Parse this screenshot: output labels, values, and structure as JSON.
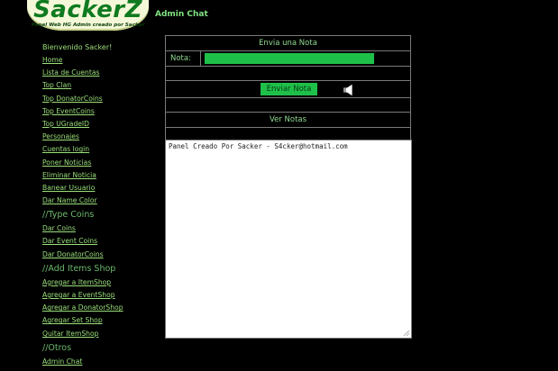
{
  "logo": {
    "title": "SackerZ",
    "subtitle": "Panel Web HG Admin creado por Sacker"
  },
  "page_title": "Admin Chat",
  "sidebar": {
    "welcome": "Bienvenido Sacker!",
    "links": [
      "Home",
      "Lista de Cuentas",
      "Top Clan",
      "Top DonatorCoins",
      "Top EventCoins",
      "Top UGradeID",
      "Personajes",
      "Cuentas login",
      "Poner Noticias",
      "Eliminar Noticia",
      "Banear Usuario",
      "Dar Name Color"
    ],
    "section_coins": "//Type Coins",
    "coins_links": [
      "Dar Coins",
      "Dar Event Coins",
      "Dar DonatorCoins"
    ],
    "section_shop": "//Add Items Shop",
    "shop_links": [
      "Agregar a ItemShop",
      "Agregar a EventShop",
      "Agregar a DonatorShop",
      "Agregar Set Shop",
      "Quitar ItemShop"
    ],
    "section_otros": "//Otros",
    "otros_links": [
      "Admin Chat"
    ]
  },
  "panel": {
    "header": "Envia una Nota",
    "nota_label": "Nota:",
    "nota_value": "",
    "send_label": "Enviar Nota",
    "view_label": "Ver Notas"
  },
  "notes_text": "Panel Creado Por Sacker - S4cker@hotmail.com",
  "colors": {
    "accent": "#1fc04a",
    "text": "#9adf7a",
    "background": "#000000"
  }
}
